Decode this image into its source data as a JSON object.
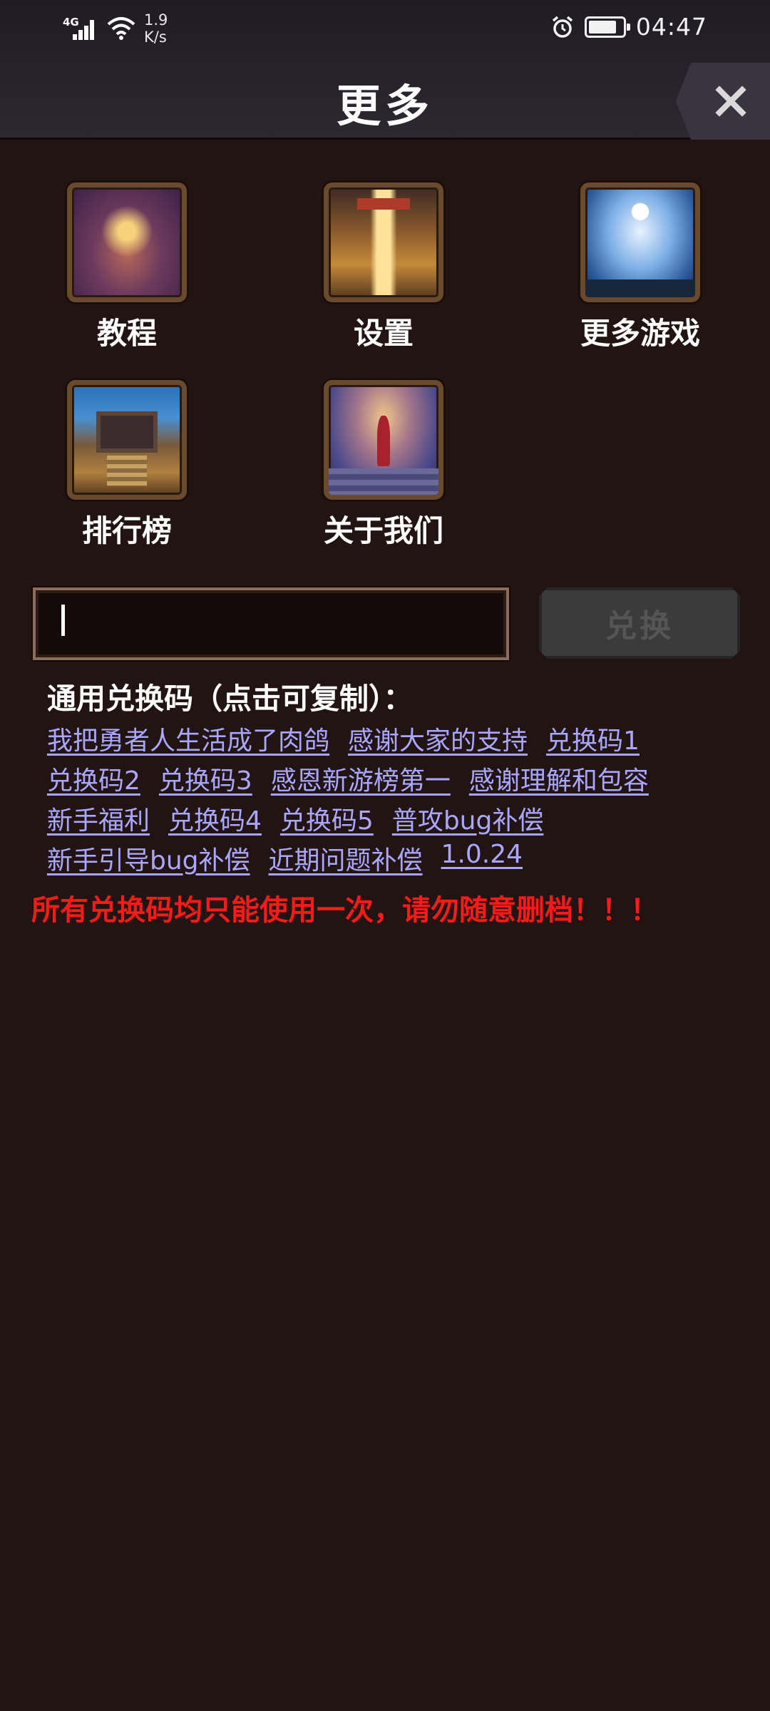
{
  "status_bar": {
    "network_type": "4G",
    "net_speed_value": "1.9",
    "net_speed_unit": "K/s",
    "time": "04:47",
    "icons": [
      "signal-icon",
      "wifi-icon",
      "alarm-icon",
      "battery-icon"
    ]
  },
  "header": {
    "title": "更多",
    "close_icon": "close-icon"
  },
  "menu": {
    "items": [
      {
        "label": "教程",
        "icon": "tutorial-icon"
      },
      {
        "label": "设置",
        "icon": "settings-icon"
      },
      {
        "label": "更多游戏",
        "icon": "more-games-icon"
      },
      {
        "label": "排行榜",
        "icon": "leaderboard-icon"
      },
      {
        "label": "关于我们",
        "icon": "about-us-icon"
      }
    ]
  },
  "redeem": {
    "input_value": "",
    "input_placeholder": "",
    "button_label": "兑换"
  },
  "codes": {
    "title": "通用兑换码（点击可复制）：",
    "rows": [
      [
        "我把勇者人生活成了肉鸽",
        "感谢大家的支持",
        "兑换码1"
      ],
      [
        "兑换码2",
        "兑换码3",
        "感恩新游榜第一",
        "感谢理解和包容"
      ],
      [
        "新手福利",
        "兑换码4",
        "兑换码5",
        "普攻bug补偿"
      ],
      [
        "新手引导bug补偿",
        "近期问题补偿",
        "1.0.24"
      ]
    ]
  },
  "notice": "所有兑换码均只能使用一次，请勿随意删档！！！",
  "colors": {
    "background": "#221412",
    "link": "#a9a7ff",
    "notice": "#ff1a1a",
    "button_disabled": "#3b3b3b"
  }
}
